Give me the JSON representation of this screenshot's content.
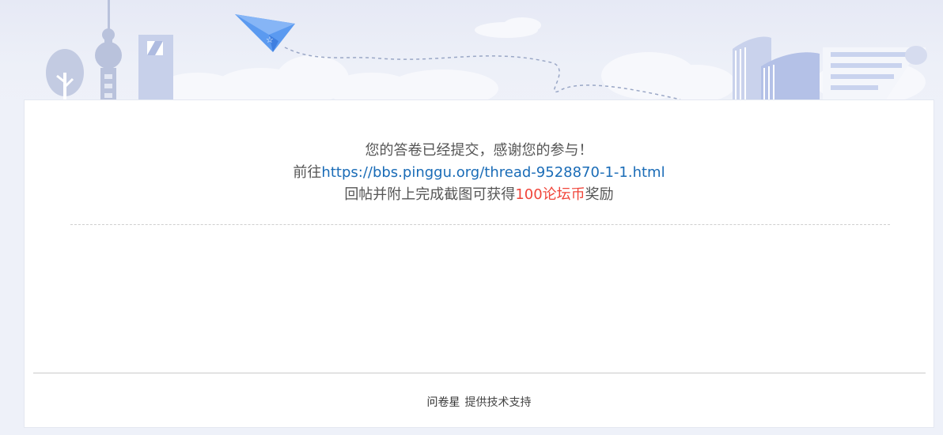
{
  "message": {
    "line1": "您的答卷已经提交，感谢您的参与！",
    "line2_prefix": "前往",
    "line2_link": "https://bbs.pinggu.org/thread-9528870-1-1.html",
    "line3_prefix": "回帖并附上完成截图可获得",
    "line3_reward": "100论坛币",
    "line3_suffix": "奖励"
  },
  "footer": {
    "brand": "问卷星",
    "text": "提供技术支持"
  },
  "banner": {
    "icons": [
      "tree-icon",
      "tv-tower-icon",
      "skyscraper-icon",
      "paper-plane-icon",
      "cloud-icon",
      "books-icon",
      "paper-scroll-icon"
    ]
  },
  "colors": {
    "link": "#1a6cb7",
    "reward": "#f0453a",
    "text": "#555555",
    "page_background": "#eef1f9"
  }
}
